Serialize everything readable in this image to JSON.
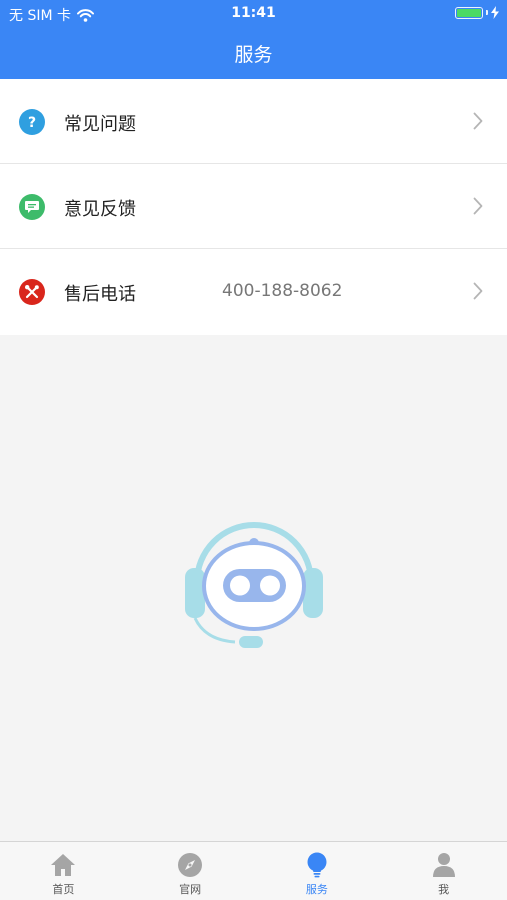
{
  "status_bar": {
    "carrier": "无 SIM 卡",
    "time": "11:41"
  },
  "header": {
    "title": "服务"
  },
  "menu": [
    {
      "label": "常见问题",
      "icon": "question-icon",
      "color": "#2f9fe0",
      "value": ""
    },
    {
      "label": "意见反馈",
      "icon": "feedback-chat-icon",
      "color": "#3dbb6a",
      "value": ""
    },
    {
      "label": "售后电话",
      "icon": "tools-icon",
      "color": "#d9261c",
      "value": "400-188-8062"
    }
  ],
  "tabbar": [
    {
      "label": "首页",
      "icon": "home-icon",
      "active": false
    },
    {
      "label": "官网",
      "icon": "compass-icon",
      "active": false
    },
    {
      "label": "服务",
      "icon": "lightbulb-icon",
      "active": true
    },
    {
      "label": "我",
      "icon": "person-icon",
      "active": false
    }
  ],
  "colors": {
    "primary": "#3a86f5",
    "inactive_icon": "#a5a5a5"
  }
}
